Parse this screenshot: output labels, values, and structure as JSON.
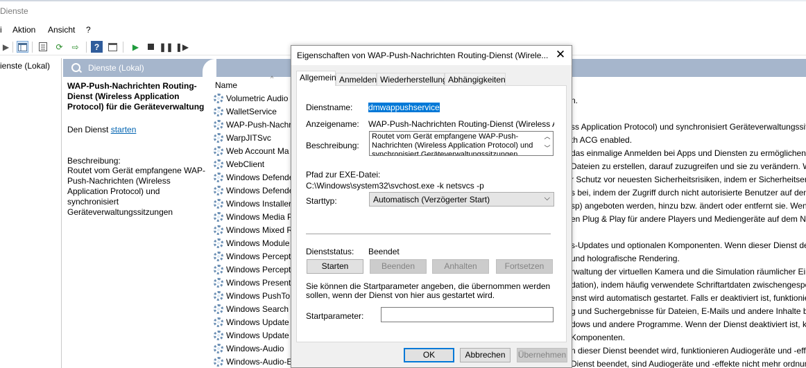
{
  "window": {
    "title": "Dienste"
  },
  "menu": {
    "items": [
      "i",
      "Aktion",
      "Ansicht",
      "?"
    ]
  },
  "tree": {
    "node": "ienste (Lokal)"
  },
  "pane": {
    "header": "Dienste (Lokal)",
    "column_name": "Name"
  },
  "details": {
    "service_name": "WAP-Push-Nachrichten Routing-Dienst (Wireless Application Protocol) für die Geräteverwaltung",
    "start_prefix": "Den Dienst ",
    "start_link": "starten",
    "desc_label": "Beschreibung:",
    "desc_text": "Routet vom Gerät empfangene WAP-Push-Nachrichten (Wireless Application Protocol) und synchronisiert Geräteverwaltungssitzungen"
  },
  "services": [
    {
      "name": "Volumetric Audio",
      "desc": "n."
    },
    {
      "name": "WalletService",
      "desc": ""
    },
    {
      "name": "WAP-Push-Nachr",
      "desc": "ss Application Protocol) und synchronisiert Geräteverwaltungssitzungen"
    },
    {
      "name": "WarpJITSvc",
      "desc": "th ACG enabled."
    },
    {
      "name": "Web Account Ma",
      "desc": "das einmalige Anmelden bei Apps und Diensten zu ermöglichen. Wenn"
    },
    {
      "name": "WebClient",
      "desc": "Dateien zu erstellen, darauf zuzugreifen und sie zu verändern. Wenn"
    },
    {
      "name": "Windows Defende",
      "desc": "r Schutz vor neuesten Sicherheitsrisiken, indem er Sicherheitsereignisse"
    },
    {
      "name": "Windows Defende",
      "desc": "s bei, indem der Zugriff durch nicht autorisierte Benutzer auf den Com"
    },
    {
      "name": "Windows Installer",
      "desc": "sp) angeboten werden, hinzu bzw. ändert oder entfernt sie. Wenn dies"
    },
    {
      "name": "Windows Media P",
      "desc": "en Plug & Play für andere Players und Mediengeräte auf dem Netzwerk"
    },
    {
      "name": "Windows Mixed R",
      "desc": ""
    },
    {
      "name": "Windows Module",
      "desc": "s-Updates und optionalen Komponenten. Wenn dieser Dienst deaktiviert"
    },
    {
      "name": "Windows Percept",
      "desc": "und holografische Rendering."
    },
    {
      "name": "Windows Percept",
      "desc": "rwaltung der virtuellen Kamera und die Simulation räumlicher Einga"
    },
    {
      "name": "Windows Presenta",
      "desc": "dation), indem häufig verwendete Schriftartdaten zwischengespeichert"
    },
    {
      "name": "Windows PushToI",
      "desc": "enst wird automatisch gestartet. Falls er deaktiviert ist, funktionieren"
    },
    {
      "name": "Windows Search",
      "desc": "g und Suchergebnisse für Dateien, E-Mails und andere Inhalte bereit."
    },
    {
      "name": "Windows Update",
      "desc": "dows und andere Programme. Wenn der Dienst deaktiviert ist, können"
    },
    {
      "name": "Windows Update",
      "desc": "Komponenten."
    },
    {
      "name": "Windows-Audio",
      "desc": "n dieser Dienst beendet wird, funktionieren Audiogeräte und -effekte"
    },
    {
      "name": "Windows-Audio-E",
      "desc": "Dienst beendet, sind Audiogeräte und -effekte nicht mehr ordnungsgem"
    }
  ],
  "dialog": {
    "title": "Eigenschaften von WAP-Push-Nachrichten Routing-Dienst (Wirele...",
    "tabs": [
      "Allgemein",
      "Anmelden",
      "Wiederherstellung",
      "Abhängigkeiten"
    ],
    "dienstname_label": "Dienstname:",
    "dienstname": "dmwappushservice",
    "anzeigename_label": "Anzeigename:",
    "anzeigename": "WAP-Push-Nachrichten Routing-Dienst (Wireless Applica",
    "beschreibung_label": "Beschreibung:",
    "beschreibung": "Routet vom Gerät empfangene WAP-Push-Nachrichten (Wireless Application Protocol) und synchronisiert Geräteverwaltungssitzungen",
    "pfad_label": "Pfad zur EXE-Datei:",
    "pfad": "C:\\Windows\\system32\\svchost.exe -k netsvcs -p",
    "starttyp_label": "Starttyp:",
    "starttyp": "Automatisch (Verzögerter Start)",
    "status_label": "Dienststatus:",
    "status": "Beendet",
    "btn_start": "Starten",
    "btn_stop": "Beenden",
    "btn_pause": "Anhalten",
    "btn_resume": "Fortsetzen",
    "hint": "Sie können die Startparameter angeben, die übernommen werden sollen, wenn der Dienst von hier aus gestartet wird.",
    "param_label": "Startparameter:",
    "param_value": "",
    "ok": "OK",
    "cancel": "Abbrechen",
    "apply": "Übernehmen"
  }
}
